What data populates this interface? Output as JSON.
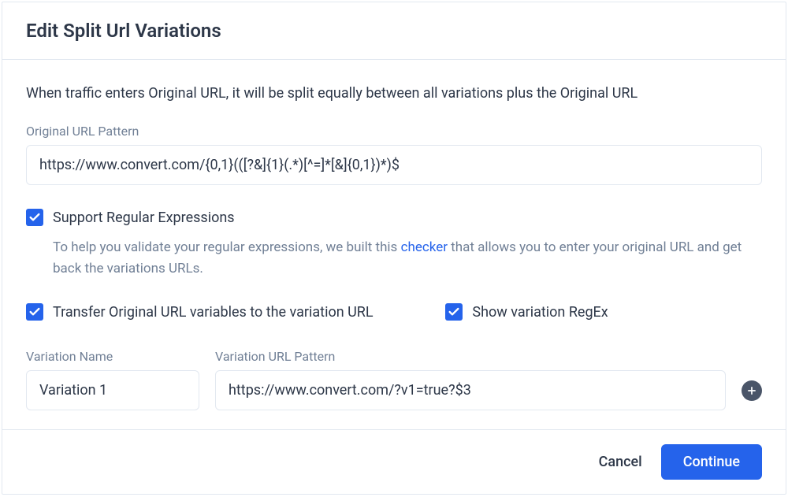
{
  "header": {
    "title": "Edit Split Url Variations"
  },
  "description": "When traffic enters Original URL, it will be split equally between all variations plus the Original URL",
  "original_url": {
    "label": "Original URL Pattern",
    "value": "https://www.convert.com/{0,1}(([?&]{1}(.*)[^=]*[&]{0,1})*)$"
  },
  "regex_checkbox": {
    "label": "Support Regular Expressions",
    "helper_before": "To help you validate your regular expressions, we built this ",
    "helper_link": "checker",
    "helper_after": " that allows you to enter your original URL and get back the variations URLs."
  },
  "transfer_checkbox": {
    "label": "Transfer Original URL variables to the variation URL"
  },
  "show_regex_checkbox": {
    "label": "Show variation RegEx"
  },
  "variation": {
    "name_label": "Variation Name",
    "url_label": "Variation URL Pattern",
    "name_value": "Variation 1",
    "url_value": "https://www.convert.com/?v1=true?$3"
  },
  "footer": {
    "cancel": "Cancel",
    "continue": "Continue"
  }
}
